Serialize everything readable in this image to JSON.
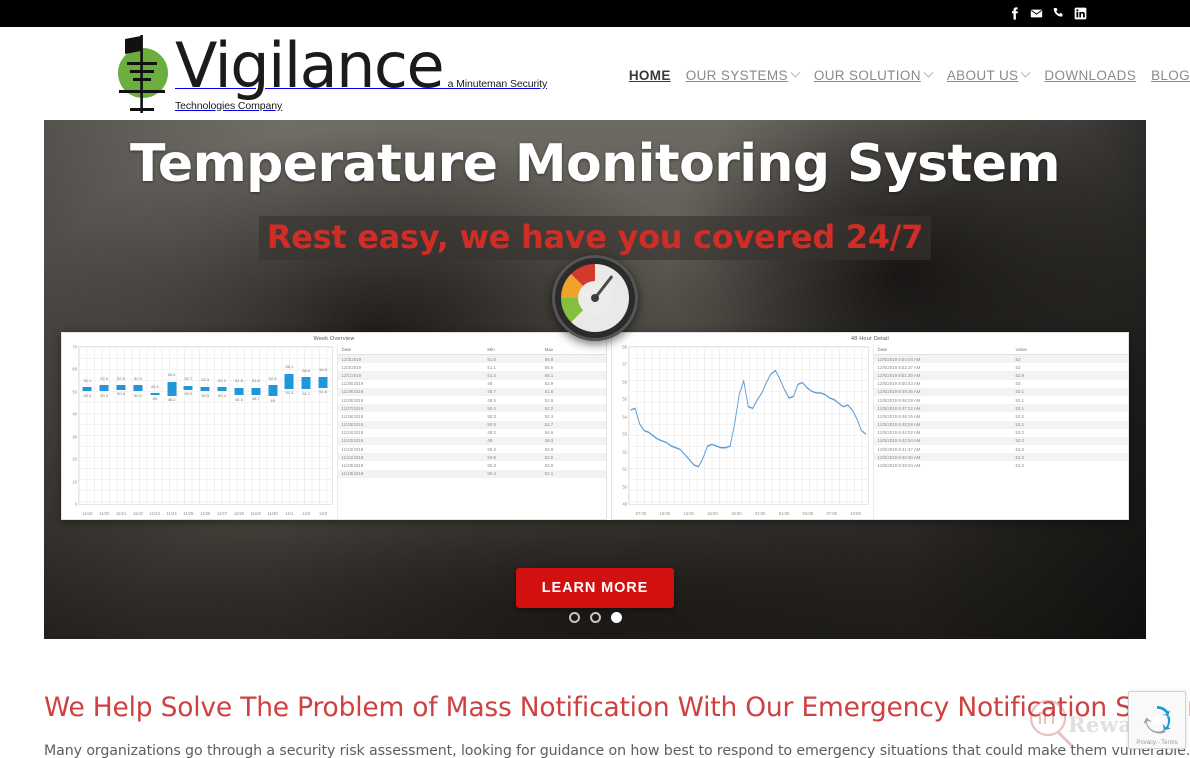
{
  "topbar": {
    "social": [
      {
        "name": "facebook-icon",
        "label": "Facebook"
      },
      {
        "name": "email-icon",
        "label": "Email"
      },
      {
        "name": "phone-icon",
        "label": "Phone"
      },
      {
        "name": "linkedin-icon",
        "label": "LinkedIn"
      }
    ]
  },
  "header": {
    "logo_word": "Vigilance",
    "logo_tagline": "a Minuteman Security Technologies Company",
    "nav": [
      {
        "label": "HOME",
        "active": true,
        "dropdown": false
      },
      {
        "label": "OUR SYSTEMS",
        "active": false,
        "dropdown": true
      },
      {
        "label": "OUR SOLUTION",
        "active": false,
        "dropdown": true
      },
      {
        "label": "ABOUT US",
        "active": false,
        "dropdown": true
      },
      {
        "label": "DOWNLOADS",
        "active": false,
        "dropdown": false
      },
      {
        "label": "BLOG",
        "active": false,
        "dropdown": false
      }
    ]
  },
  "hero": {
    "title": "Temperature Monitoring System",
    "subtitle": "Rest easy, we have you covered 24/7",
    "cta_label": "LEARN MORE",
    "accent_red": "#d2100f",
    "subtitle_red": "#cf2d26",
    "slides": [
      {
        "index": 1,
        "active": false
      },
      {
        "index": 2,
        "active": false
      },
      {
        "index": 3,
        "active": true
      }
    ],
    "gauge_icon": "gauge-meter-icon"
  },
  "section": {
    "heading": "We Help Solve The Problem of Mass Notification With Our Emergency Notification System",
    "body": "Many organizations go through a security risk assessment, looking for guidance on how best to respond to emergency situations that could make them vulnerable. They",
    "heading_color": "#cf4040"
  },
  "watermark": {
    "text": "Rewardi"
  },
  "recaptcha": {
    "footer": "Privacy - Terms"
  },
  "chart_data": [
    {
      "type": "bar",
      "title": "Week Overview",
      "xlabel": "",
      "ylabel": "",
      "ylim": [
        0,
        70
      ],
      "yticks": [
        0,
        10,
        20,
        30,
        40,
        50,
        60,
        70
      ],
      "grid": true,
      "categories": [
        "11/19",
        "11/20",
        "11/21",
        "11/22",
        "11/23",
        "11/24",
        "11/25",
        "11/26",
        "11/27",
        "11/28",
        "11/29",
        "11/30",
        "12/1",
        "12/2",
        "12/3"
      ],
      "series": [
        {
          "name": "Min",
          "values": [
            50.4,
            50.3,
            50.9,
            50.2,
            49.0,
            48.2,
            50.9,
            50.3,
            50.4,
            48.5,
            48.7,
            48.0,
            51.4,
            51.1,
            51.8
          ]
        },
        {
          "name": "Max",
          "values": [
            52.1,
            52.9,
            52.9,
            52.9,
            49.3,
            54.6,
            52.7,
            52.3,
            52.2,
            51.8,
            51.8,
            52.9,
            58.1,
            56.5,
            56.8
          ]
        }
      ]
    },
    {
      "type": "line",
      "title": "48 Hour Detail",
      "xlabel": "",
      "ylabel": "",
      "ylim": [
        49,
        58
      ],
      "yticks": [
        49,
        50,
        51,
        52,
        53,
        54,
        55,
        56,
        57,
        58
      ],
      "xticks": [
        "07:00",
        "10:00",
        "13:00",
        "16:00",
        "19:00",
        "22:00",
        "01:00",
        "04:00",
        "07:00",
        "10:00"
      ],
      "grid": true,
      "values": [
        54.4,
        54.5,
        53.6,
        53.2,
        53.1,
        52.9,
        52.7,
        52.6,
        52.5,
        52.3,
        52.2,
        52.1,
        51.8,
        51.5,
        51.2,
        51.1,
        51.6,
        52.3,
        52.4,
        52.3,
        52.2,
        52.2,
        52.3,
        53.6,
        55.3,
        56.1,
        54.6,
        54.5,
        55.0,
        55.4,
        56.0,
        56.5,
        56.7,
        56.2,
        55.6,
        55.1,
        55.2,
        55.9,
        56.0,
        55.7,
        55.5,
        55.4,
        55.4,
        55.3,
        55.1,
        55.0,
        54.8,
        54.6,
        54.7,
        54.4,
        53.9,
        53.2,
        53.0
      ]
    }
  ],
  "table_week": {
    "columns": [
      "Date",
      "Min",
      "Max"
    ],
    "rows": [
      [
        "12/3/2019",
        "51.8",
        "56.8"
      ],
      [
        "12/2/2019",
        "51.1",
        "56.5"
      ],
      [
        "12/1/2019",
        "51.4",
        "58.1"
      ],
      [
        "11/30/2019",
        "48",
        "52.9"
      ],
      [
        "11/29/2019",
        "48.7",
        "51.8"
      ],
      [
        "11/28/2019",
        "48.5",
        "51.8"
      ],
      [
        "11/27/2019",
        "50.4",
        "52.2"
      ],
      [
        "11/26/2019",
        "50.3",
        "52.3"
      ],
      [
        "11/25/2019",
        "50.9",
        "52.7"
      ],
      [
        "11/24/2019",
        "48.2",
        "54.6"
      ],
      [
        "11/23/2019",
        "49",
        "49.3"
      ],
      [
        "11/22/2019",
        "50.2",
        "52.9"
      ],
      [
        "11/21/2019",
        "50.9",
        "52.9"
      ],
      [
        "11/20/2019",
        "50.3",
        "52.9"
      ],
      [
        "11/19/2019",
        "50.4",
        "52.1"
      ]
    ]
  },
  "table_detail": {
    "columns": [
      "Date",
      "Value"
    ],
    "rows": [
      [
        "12/5/2019 8:54:04 AM",
        "53"
      ],
      [
        "12/5/2019 8:52:37 AM",
        "53"
      ],
      [
        "12/5/2019 8:51:30 AM",
        "52.9"
      ],
      [
        "12/5/2019 8:50:43 AM",
        "53"
      ],
      [
        "12/5/2019 8:49:36 AM",
        "53.1"
      ],
      [
        "12/5/2019 8:48:29 AM",
        "53.1"
      ],
      [
        "12/5/2019 8:47:22 AM",
        "53.1"
      ],
      [
        "12/5/2019 8:46:15 AM",
        "53.2"
      ],
      [
        "12/5/2019 8:45:08 AM",
        "53.1"
      ],
      [
        "12/5/2019 8:44:02 AM",
        "53.2"
      ],
      [
        "12/5/2019 8:42:54 AM",
        "53.2"
      ],
      [
        "12/5/2019 8:41:47 AM",
        "53.2"
      ],
      [
        "12/5/2019 8:40:40 AM",
        "53.2"
      ],
      [
        "12/5/2019 8:39:34 AM",
        "53.2"
      ]
    ]
  }
}
